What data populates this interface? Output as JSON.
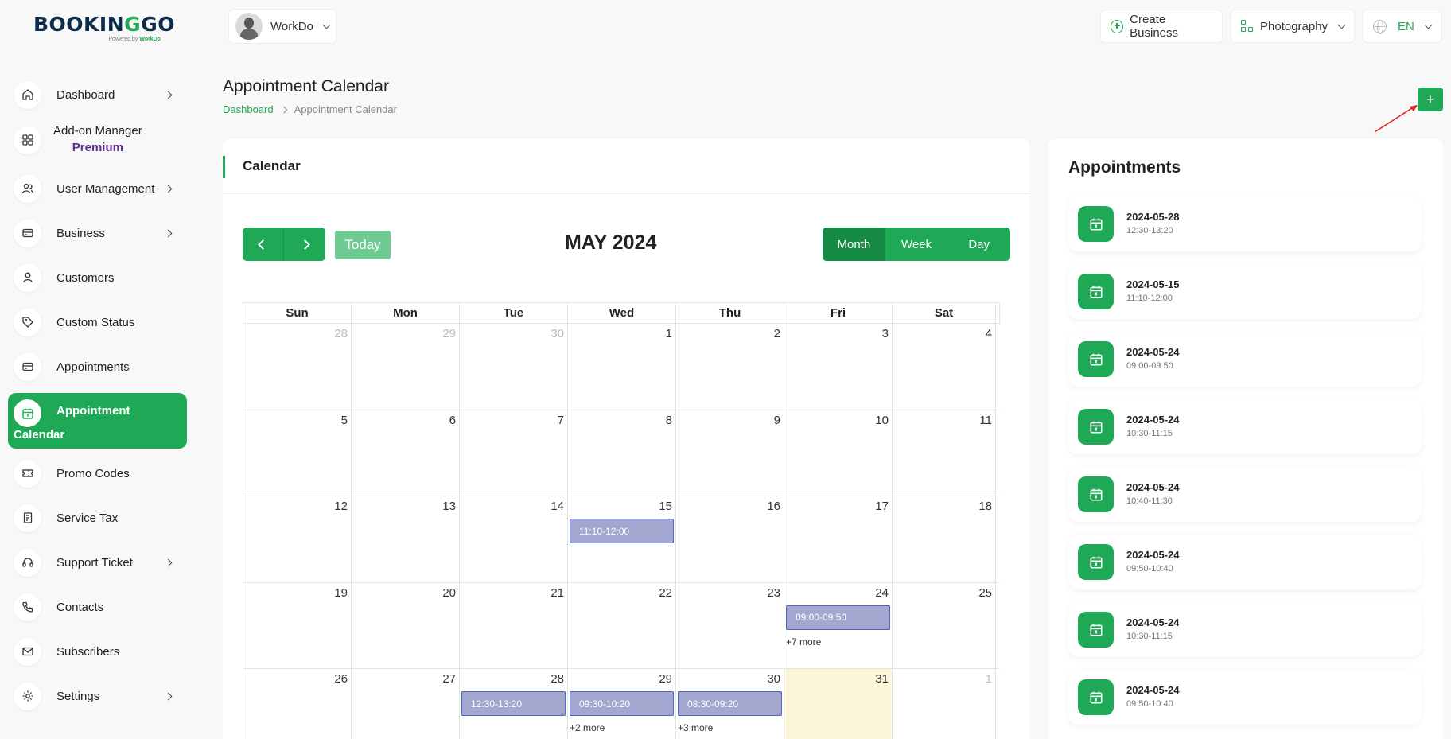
{
  "brand": {
    "logo_main_1": "BOOKIN",
    "logo_main_2": "G",
    "logo_main_3": "GO",
    "powered_by": "Powered by",
    "powered_brand": "WorkDo"
  },
  "workspace": {
    "name": "WorkDo"
  },
  "topbar": {
    "create_business": "Create Business",
    "business_select": "Photography",
    "language": "EN"
  },
  "sidebar": {
    "items": [
      {
        "label": "Dashboard",
        "icon": "home-icon",
        "arrow": true
      },
      {
        "label": "Add-on Manager",
        "sublabel": "Premium",
        "icon": "grid-icon",
        "arrow": false
      },
      {
        "label": "User Management",
        "icon": "users-icon",
        "arrow": true
      },
      {
        "label": "Business",
        "icon": "card-icon",
        "arrow": true
      },
      {
        "label": "Customers",
        "icon": "user-icon",
        "arrow": false
      },
      {
        "label": "Custom Status",
        "icon": "tag-icon",
        "arrow": false
      },
      {
        "label": "Appointments",
        "icon": "card-icon",
        "arrow": false
      },
      {
        "label": "Appointment",
        "label2": "Calendar",
        "icon": "calendar-icon",
        "arrow": false
      },
      {
        "label": "Promo Codes",
        "icon": "ticket-icon",
        "arrow": false
      },
      {
        "label": "Service Tax",
        "icon": "receipt-icon",
        "arrow": false
      },
      {
        "label": "Support Ticket",
        "icon": "headset-icon",
        "arrow": true
      },
      {
        "label": "Contacts",
        "icon": "phone-icon",
        "arrow": false
      },
      {
        "label": "Subscribers",
        "icon": "mail-icon",
        "arrow": false
      },
      {
        "label": "Settings",
        "icon": "gear-icon",
        "arrow": true
      }
    ]
  },
  "page": {
    "title": "Appointment Calendar",
    "breadcrumb": [
      "Dashboard",
      "Appointment Calendar"
    ],
    "add_label": "+"
  },
  "calendar": {
    "header": "Calendar",
    "today_label": "Today",
    "month_title": "MAY 2024",
    "views": [
      "Month",
      "Week",
      "Day"
    ],
    "selected_view": "Month",
    "days_of_week": [
      "Sun",
      "Mon",
      "Tue",
      "Wed",
      "Thu",
      "Fri",
      "Sat"
    ],
    "weeks": [
      [
        {
          "n": "28",
          "o": true
        },
        {
          "n": "29",
          "o": true
        },
        {
          "n": "30",
          "o": true
        },
        {
          "n": "1"
        },
        {
          "n": "2"
        },
        {
          "n": "3"
        },
        {
          "n": "4"
        }
      ],
      [
        {
          "n": "5"
        },
        {
          "n": "6"
        },
        {
          "n": "7"
        },
        {
          "n": "8"
        },
        {
          "n": "9"
        },
        {
          "n": "10"
        },
        {
          "n": "11"
        }
      ],
      [
        {
          "n": "12"
        },
        {
          "n": "13"
        },
        {
          "n": "14"
        },
        {
          "n": "15",
          "event": "11:10-12:00"
        },
        {
          "n": "16"
        },
        {
          "n": "17"
        },
        {
          "n": "18"
        }
      ],
      [
        {
          "n": "19"
        },
        {
          "n": "20"
        },
        {
          "n": "21"
        },
        {
          "n": "22"
        },
        {
          "n": "23"
        },
        {
          "n": "24",
          "event": "09:00-09:50",
          "more": "+7 more"
        },
        {
          "n": "25"
        }
      ],
      [
        {
          "n": "26"
        },
        {
          "n": "27"
        },
        {
          "n": "28",
          "event": "12:30-13:20"
        },
        {
          "n": "29",
          "event": "09:30-10:20",
          "more": "+2 more"
        },
        {
          "n": "30",
          "event": "08:30-09:20",
          "more": "+3 more"
        },
        {
          "n": "31",
          "today": true
        },
        {
          "n": "1",
          "o": true
        }
      ]
    ]
  },
  "appointments": {
    "title": "Appointments",
    "items": [
      {
        "date": "2024-05-28",
        "time": "12:30-13:20"
      },
      {
        "date": "2024-05-15",
        "time": "11:10-12:00"
      },
      {
        "date": "2024-05-24",
        "time": "09:00-09:50"
      },
      {
        "date": "2024-05-24",
        "time": "10:30-11:15"
      },
      {
        "date": "2024-05-24",
        "time": "10:40-11:30"
      },
      {
        "date": "2024-05-24",
        "time": "09:50-10:40"
      },
      {
        "date": "2024-05-24",
        "time": "10:30-11:15"
      },
      {
        "date": "2024-05-24",
        "time": "09:50-10:40"
      }
    ]
  },
  "colors": {
    "accent": "#1fa855",
    "event_bg": "#a3a7cf",
    "event_border": "#4f63c4",
    "today_bg": "#fdf6da"
  }
}
